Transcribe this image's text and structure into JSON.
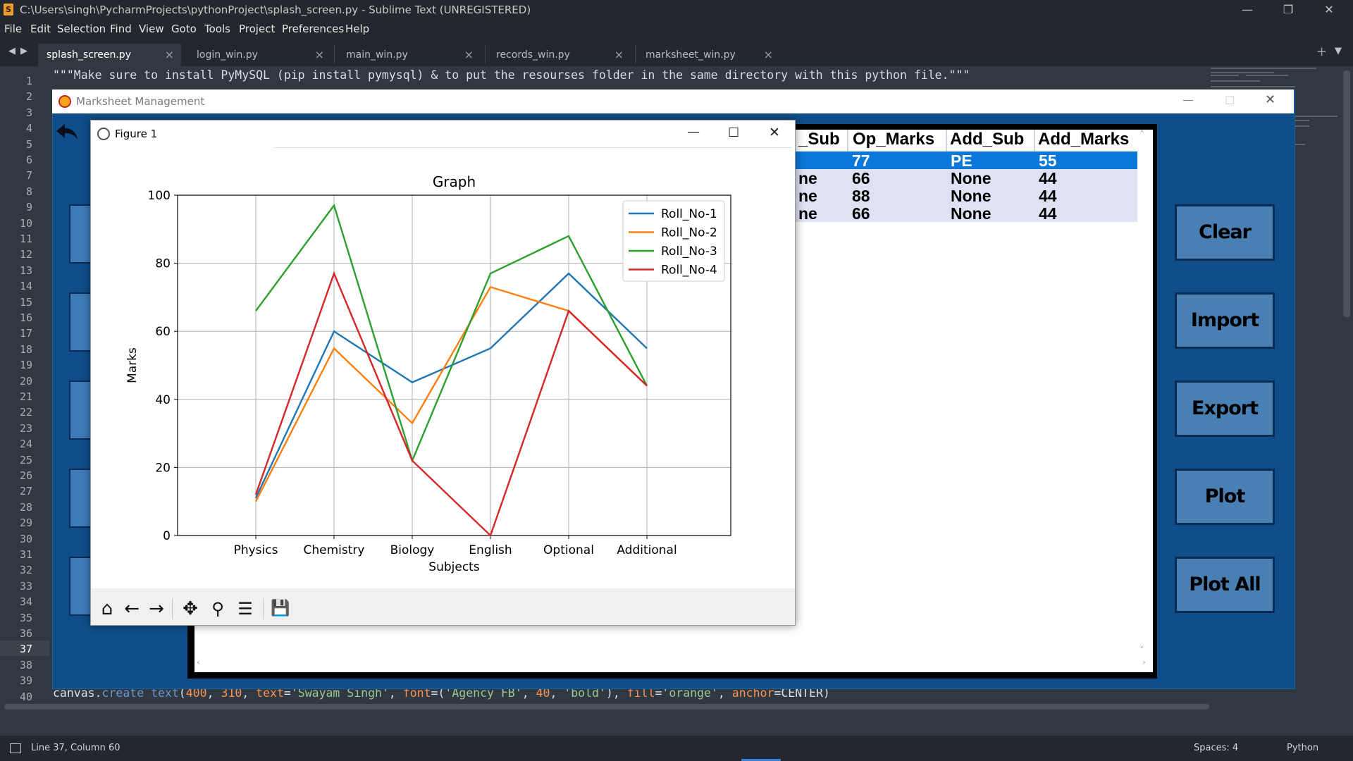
{
  "editor": {
    "window_title": "C:\\Users\\singh\\PycharmProjects\\pythonProject\\splash_screen.py - Sublime Text (UNREGISTERED)",
    "app_icon": "S",
    "menu": [
      "File",
      "Edit",
      "Selection",
      "Find",
      "View",
      "Goto",
      "Tools",
      "Project",
      "Preferences",
      "Help"
    ],
    "tabs": [
      {
        "label": "splash_screen.py",
        "active": true
      },
      {
        "label": "login_win.py",
        "active": false
      },
      {
        "label": "main_win.py",
        "active": false
      },
      {
        "label": "records_win.py",
        "active": false
      },
      {
        "label": "marksheet_win.py",
        "active": false
      }
    ],
    "line_numbers": [
      "1",
      "2",
      "3",
      "4",
      "5",
      "6",
      "7",
      "8",
      "9",
      "10",
      "11",
      "12",
      "13",
      "14",
      "15",
      "16",
      "17",
      "18",
      "19",
      "20",
      "21",
      "22",
      "23",
      "24",
      "25",
      "26",
      "27",
      "28",
      "29",
      "30",
      "31",
      "32",
      "33",
      "34",
      "35",
      "36",
      "37",
      "38",
      "39",
      "40"
    ],
    "current_line": "37",
    "code_line_1": "\"\"\"Make sure to install PyMySQL (pip install pymysql) & to put the resourses folder in the same directory with this python file.\"\"\"",
    "code_line_40": {
      "p1": "canvas.",
      "p2": "create text",
      "p3": "(",
      "p4": "400",
      "p5": ", ",
      "p6": "310",
      "p7": ", ",
      "p8": "text",
      "p9": "=",
      "p10": "'Swayam Singh'",
      "p11": ", ",
      "p12": "font",
      "p13": "=(",
      "p14": "'Agency FB'",
      "p15": ", ",
      "p16": "40",
      "p17": ", ",
      "p18": "'bold'",
      "p19": "), ",
      "p20": "fill",
      "p21": "=",
      "p22": "'orange'",
      "p23": ", ",
      "p24": "anchor",
      "p25": "=CENTER)"
    },
    "status_position": "Line 37, Column 60",
    "status_spaces": "Spaces: 4",
    "status_syntax": "Python"
  },
  "marksheet": {
    "title": "Marksheet Management",
    "buttons": [
      "Clear",
      "Import",
      "Export",
      "Plot",
      "Plot All"
    ],
    "table": {
      "headers": [
        "_Sub",
        "Op_Marks",
        "Add_Sub",
        "Add_Marks"
      ],
      "rows": [
        {
          "op_sub": "",
          "op_marks": "77",
          "add_sub": "PE",
          "add_marks": "55",
          "selected": true
        },
        {
          "op_sub": "ne",
          "op_marks": "66",
          "add_sub": "None",
          "add_marks": "44",
          "selected": false
        },
        {
          "op_sub": "ne",
          "op_marks": "88",
          "add_sub": "None",
          "add_marks": "44",
          "selected": false
        },
        {
          "op_sub": "ne",
          "op_marks": "66",
          "add_sub": "None",
          "add_marks": "44",
          "selected": false
        }
      ]
    }
  },
  "figure": {
    "window_title": "Figure 1",
    "toolbar": [
      "home-icon",
      "back-arrow-icon",
      "forward-arrow-icon",
      "pan-icon",
      "zoom-icon",
      "configure-subplots-icon",
      "save-icon"
    ]
  },
  "chart_data": {
    "type": "line",
    "title": "Graph",
    "xlabel": "Subjects",
    "ylabel": "Marks",
    "categories": [
      "Physics",
      "Chemistry",
      "Biology",
      "English",
      "Optional",
      "Additional"
    ],
    "ylim": [
      0,
      100
    ],
    "yticks": [
      "0",
      "20",
      "40",
      "60",
      "80",
      "100"
    ],
    "grid": true,
    "legend_position": "top-right",
    "series": [
      {
        "name": "Roll_No-1",
        "color": "#1f77b4",
        "values": [
          11,
          60,
          45,
          55,
          77,
          55
        ]
      },
      {
        "name": "Roll_No-2",
        "color": "#ff7f0e",
        "values": [
          10,
          55,
          33,
          73,
          66,
          44
        ]
      },
      {
        "name": "Roll_No-3",
        "color": "#2ca02c",
        "values": [
          66,
          97,
          22,
          77,
          88,
          44
        ]
      },
      {
        "name": "Roll_No-4",
        "color": "#d62728",
        "values": [
          12,
          77,
          22,
          0,
          66,
          44
        ]
      }
    ]
  }
}
